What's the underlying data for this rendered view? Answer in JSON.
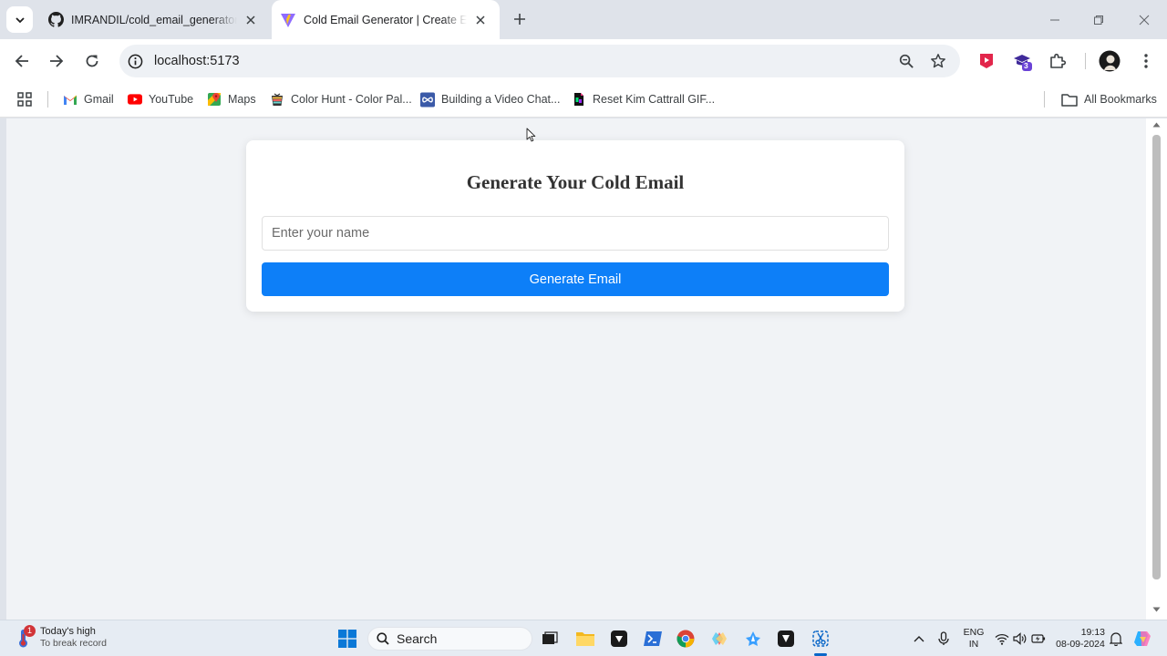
{
  "browser": {
    "tabs": [
      {
        "title": "IMRANDIL/cold_email_generator_",
        "favicon": "github-icon",
        "active": false
      },
      {
        "title": "Cold Email Generator | Create Effe",
        "favicon": "vite-icon",
        "active": true
      }
    ],
    "url": "localhost:5173",
    "extension_badge": "3",
    "bookmarks": [
      {
        "label": "Gmail",
        "icon": "gmail-icon"
      },
      {
        "label": "YouTube",
        "icon": "youtube-icon"
      },
      {
        "label": "Maps",
        "icon": "maps-icon"
      },
      {
        "label": "Color Hunt - Color Pal...",
        "icon": "colorhunt-icon"
      },
      {
        "label": "Building a Video Chat...",
        "icon": "infinity-icon"
      },
      {
        "label": "Reset Kim Cattrall GIF...",
        "icon": "gif-icon"
      }
    ],
    "all_bookmarks_label": "All Bookmarks"
  },
  "page": {
    "heading": "Generate Your Cold Email",
    "name_placeholder": "Enter your name",
    "name_value": "",
    "button_label": "Generate Email",
    "accent_color": "#0d7ff8"
  },
  "taskbar": {
    "weather_badge": "1",
    "weather_title": "Today's high",
    "weather_subtitle": "To break record",
    "search_label": "Search",
    "language_line1": "ENG",
    "language_line2": "IN",
    "time": "19:13",
    "date": "08-09-2024"
  }
}
